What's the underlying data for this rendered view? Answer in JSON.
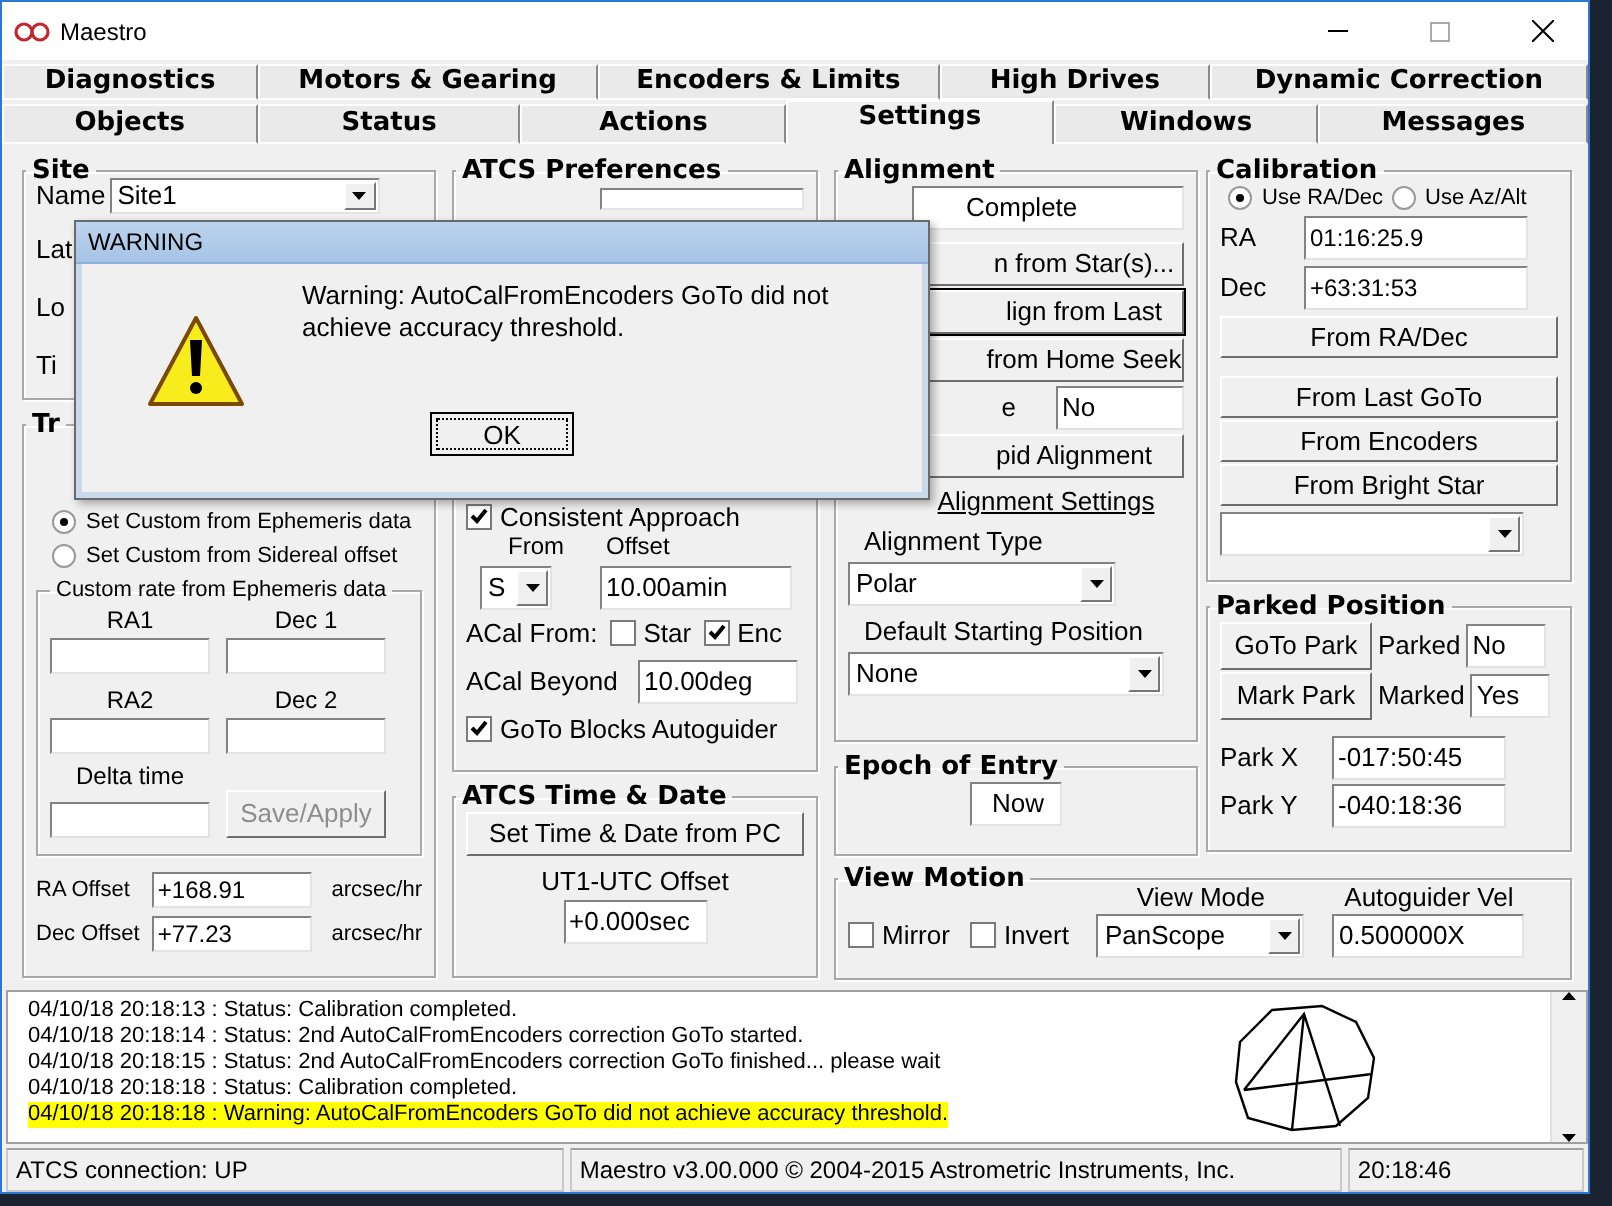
{
  "window": {
    "title": "Maestro"
  },
  "tab_rows": [
    [
      {
        "label": "Diagnostics",
        "selected": false
      },
      {
        "label": "Motors & Gearing",
        "selected": false
      },
      {
        "label": "Encoders & Limits",
        "selected": false
      },
      {
        "label": "High Drives",
        "selected": false
      },
      {
        "label": "Dynamic Correction",
        "selected": false
      }
    ],
    [
      {
        "label": "Objects",
        "selected": false
      },
      {
        "label": "Status",
        "selected": false
      },
      {
        "label": "Actions",
        "selected": false
      },
      {
        "label": "Settings",
        "selected": true
      },
      {
        "label": "Windows",
        "selected": false
      },
      {
        "label": "Messages",
        "selected": false
      }
    ]
  ],
  "site": {
    "title": "Site",
    "name_label": "Name",
    "name_value": "Site1",
    "labels": [
      "Lat",
      "Lo",
      "Ti"
    ]
  },
  "tracking": {
    "title": "Tr",
    "radios": [
      {
        "label": "Set Custom from Ephemeris data",
        "selected": true
      },
      {
        "label": "Set Custom from Sidereal offset",
        "selected": false
      }
    ],
    "ephemeris": {
      "title": "Custom rate from Ephemeris data",
      "fields": [
        {
          "label": "RA1"
        },
        {
          "label": "Dec 1"
        },
        {
          "label": "RA2"
        },
        {
          "label": "Dec 2"
        },
        {
          "label": "Delta time"
        }
      ],
      "save_button": {
        "label": "Save/Apply",
        "disabled": true
      }
    },
    "offsets": [
      {
        "label": "RA Offset",
        "value": "+168.91",
        "unit": "arcsec/hr"
      },
      {
        "label": "Dec Offset",
        "value": "+77.23",
        "unit": "arcsec/hr"
      }
    ]
  },
  "atcs_preferences": {
    "title": "ATCS Preferences",
    "consistent_approach": {
      "label": "Consistent Approach",
      "checked": true
    },
    "from_label": "From",
    "offset_label": "Offset",
    "from_value": "S",
    "offset_value": "10.00amin",
    "acal_from_label": "ACal From:",
    "acal_sources": [
      {
        "label": "Star",
        "checked": false
      },
      {
        "label": "Enc",
        "checked": true
      }
    ],
    "acal_beyond_label": "ACal Beyond",
    "acal_beyond_value": "10.00deg",
    "goto_blocks": {
      "label": "GoTo Blocks Autoguider",
      "checked": true
    }
  },
  "time_date": {
    "title": "ATCS Time & Date",
    "button": "Set Time & Date from PC",
    "ut1_label": "UT1-UTC Offset",
    "ut1_value": "+0.000sec"
  },
  "alignment": {
    "title": "Alignment",
    "status_value": "Complete",
    "buttons": [
      {
        "label": "n from Star(s)...",
        "default": false
      },
      {
        "label": "lign from Last",
        "default": true
      },
      {
        "label": "from Home Seek",
        "default": false
      }
    ],
    "flag_label": "e",
    "flag_value": "No",
    "rapid_button": "pid Alignment",
    "settings_link": "Alignment Settings",
    "type_label": "Alignment Type",
    "type_value": "Polar",
    "start_label": "Default Starting Position",
    "start_value": "None"
  },
  "epoch": {
    "title": "Epoch of Entry",
    "value": "Now"
  },
  "calibration": {
    "title": "Calibration",
    "modes": [
      {
        "label": "Use RA/Dec",
        "selected": true
      },
      {
        "label": "Use Az/Alt",
        "selected": false
      }
    ],
    "ra_label": "RA",
    "ra_value": "01:16:25.9",
    "dec_label": "Dec",
    "dec_value": "+63:31:53",
    "buttons": [
      "From RA/Dec",
      "From Last GoTo",
      "From Encoders",
      "From Bright Star"
    ]
  },
  "parked": {
    "title": "Parked Position",
    "goto_button": "GoTo Park",
    "mark_button": "Mark Park",
    "parked_label": "Parked",
    "parked_value": "No",
    "marked_label": "Marked",
    "marked_value": "Yes",
    "park_x_label": "Park X",
    "park_x_value": "-017:50:45",
    "park_y_label": "Park Y",
    "park_y_value": "-040:18:36"
  },
  "view_motion": {
    "title": "View Motion",
    "options": [
      {
        "label": "Mirror",
        "checked": false
      },
      {
        "label": "Invert",
        "checked": false
      }
    ],
    "mode_label": "View Mode",
    "mode_value": "PanScope",
    "vel_label": "Autoguider Vel",
    "vel_value": "0.500000X"
  },
  "log": [
    {
      "text": "04/10/18 20:18:13 : Status: Calibration completed.",
      "highlighted": false
    },
    {
      "text": "04/10/18 20:18:14 : Status: 2nd AutoCalFromEncoders correction GoTo started.",
      "highlighted": false
    },
    {
      "text": "04/10/18 20:18:15 : Status: 2nd AutoCalFromEncoders correction GoTo finished... please wait",
      "highlighted": false
    },
    {
      "text": "04/10/18 20:18:18 : Status: Calibration completed.",
      "highlighted": false
    },
    {
      "text": "04/10/18 20:18:18 : Warning: AutoCalFromEncoders GoTo did not achieve accuracy threshold.",
      "highlighted": true
    }
  ],
  "status_bar": [
    "ATCS connection: UP",
    "Maestro v3.00.000 © 2004-2015 Astrometric Instruments, Inc.",
    "20:18:46"
  ],
  "dialog": {
    "title": "WARNING",
    "message": "Warning: AutoCalFromEncoders GoTo did not achieve accuracy threshold.",
    "button": "OK"
  }
}
